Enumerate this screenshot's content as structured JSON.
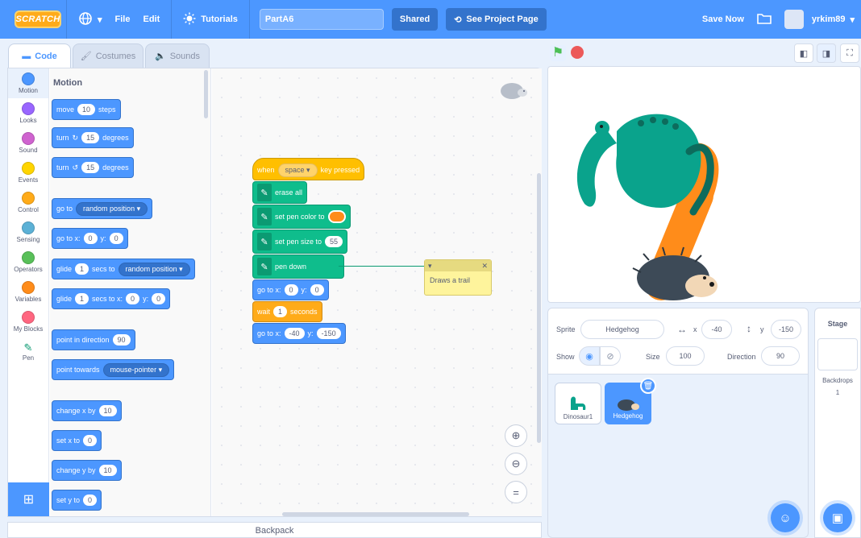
{
  "topbar": {
    "logo": "SCRATCH",
    "menus": {
      "globe": "globe-icon",
      "file": "File",
      "edit": "Edit",
      "tutorials": "Tutorials"
    },
    "project_title": "PartA6",
    "shared": "Shared",
    "see_project": "See Project Page",
    "save_now": "Save Now",
    "username": "yrkim89"
  },
  "tabs": {
    "code": "Code",
    "costumes": "Costumes",
    "sounds": "Sounds"
  },
  "categories": [
    "Motion",
    "Looks",
    "Sound",
    "Events",
    "Control",
    "Sensing",
    "Operators",
    "Variables",
    "My Blocks",
    "Pen"
  ],
  "category_colors": [
    "#4c97ff",
    "#9966ff",
    "#cf63cf",
    "#ffd500",
    "#ffab19",
    "#5cb1d6",
    "#59c059",
    "#ff8c1a",
    "#ff6680",
    "#0fbd8c"
  ],
  "palette": {
    "heading": "Motion",
    "move": {
      "a": "move",
      "steps": "10",
      "b": "steps"
    },
    "turn_right": {
      "a": "turn",
      "deg": "15",
      "b": "degrees"
    },
    "turn_left": {
      "a": "turn",
      "deg": "15",
      "b": "degrees"
    },
    "goto": {
      "a": "go to",
      "dd": "random position"
    },
    "goto_xy": {
      "a": "go to x:",
      "x": "0",
      "b": "y:",
      "y": "0"
    },
    "glide": {
      "a": "glide",
      "secs": "1",
      "b": "secs to",
      "dd": "random position"
    },
    "glide_xy": {
      "a": "glide",
      "secs": "1",
      "b": "secs to x:",
      "x": "0",
      "c": "y:",
      "y": "0"
    },
    "point_dir": {
      "a": "point in direction",
      "v": "90"
    },
    "point_towards": {
      "a": "point towards",
      "dd": "mouse-pointer"
    },
    "change_x": {
      "a": "change x by",
      "v": "10"
    },
    "set_x": {
      "a": "set x to",
      "v": "0"
    },
    "change_y": {
      "a": "change y by",
      "v": "10"
    },
    "set_y": {
      "a": "set y to",
      "v": "0"
    }
  },
  "script": {
    "hat": {
      "a": "when",
      "key": "space",
      "b": "key pressed"
    },
    "erase": "erase all",
    "color": "set pen color to",
    "size": {
      "a": "set pen size to",
      "v": "55"
    },
    "pendown": "pen down",
    "goto1": {
      "a": "go to x:",
      "x": "0",
      "b": "y:",
      "y": "0"
    },
    "wait": {
      "a": "wait",
      "v": "1",
      "b": "seconds"
    },
    "goto2": {
      "a": "go to x:",
      "x": "-40",
      "b": "y:",
      "y": "-150"
    },
    "comment": "Draws a trail",
    "pen_color": "#ff8c1a"
  },
  "backpack": "Backpack",
  "sprite_info": {
    "sprite_label": "Sprite",
    "sprite_name": "Hedgehog",
    "x_label": "x",
    "x": "-40",
    "y_label": "y",
    "y": "-150",
    "show_label": "Show",
    "size_label": "Size",
    "size": "100",
    "direction_label": "Direction",
    "direction": "90"
  },
  "sprites": [
    {
      "name": "Dinosaur1"
    },
    {
      "name": "Hedgehog"
    }
  ],
  "stage_panel": {
    "title": "Stage",
    "backdrops_label": "Backdrops",
    "backdrops_count": "1"
  },
  "colors": {
    "accent": "#4c97ff",
    "motion": "#4c97ff",
    "pen": "#0fbd8c",
    "events": "#ffbf00",
    "control": "#ffab19"
  }
}
